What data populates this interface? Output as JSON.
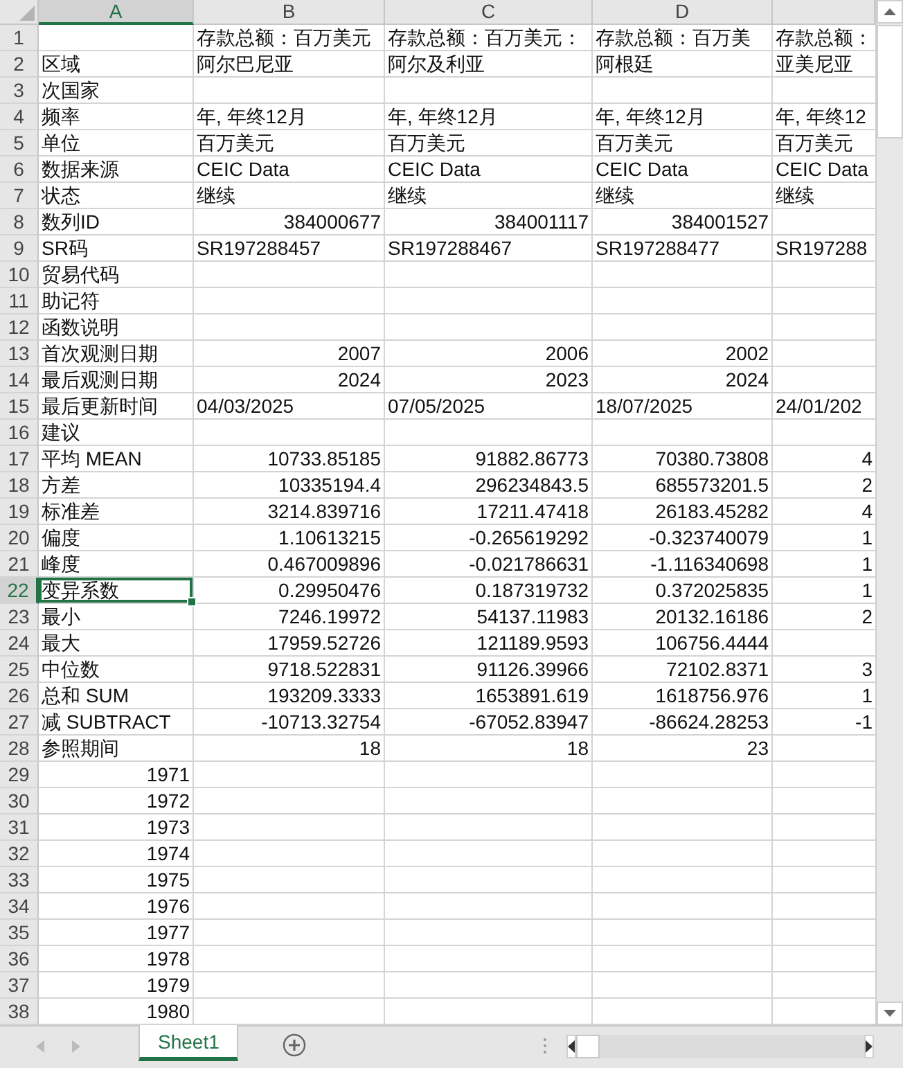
{
  "columns": [
    {
      "label": "A",
      "selected": true
    },
    {
      "label": "B",
      "selected": false
    },
    {
      "label": "C",
      "selected": false
    },
    {
      "label": "D",
      "selected": false
    }
  ],
  "rows": [
    {
      "number": "1",
      "selected": false,
      "kind": "text",
      "cells": [
        null,
        "存款总额：百万美元",
        "存款总额：百万美元：",
        "存款总额：百万美",
        "存款总额："
      ]
    },
    {
      "number": "2",
      "selected": false,
      "kind": "text",
      "cells": [
        "区域",
        "阿尔巴尼亚",
        "阿尔及利亚",
        "阿根廷",
        "亚美尼亚"
      ]
    },
    {
      "number": "3",
      "selected": false,
      "kind": "text",
      "cells": [
        "次国家",
        null,
        null,
        null,
        null
      ]
    },
    {
      "number": "4",
      "selected": false,
      "kind": "text",
      "cells": [
        "频率",
        "年, 年终12月",
        "年, 年终12月",
        "年, 年终12月",
        "年, 年终12"
      ]
    },
    {
      "number": "5",
      "selected": false,
      "kind": "text",
      "cells": [
        "单位",
        "百万美元",
        "百万美元",
        "百万美元",
        "百万美元"
      ]
    },
    {
      "number": "6",
      "selected": false,
      "kind": "text",
      "cells": [
        "数据来源",
        "CEIC Data",
        "CEIC Data",
        "CEIC Data",
        "CEIC Data"
      ]
    },
    {
      "number": "7",
      "selected": false,
      "kind": "text",
      "cells": [
        "状态",
        "继续",
        "继续",
        "继续",
        "继续"
      ]
    },
    {
      "number": "8",
      "selected": false,
      "kind": "number",
      "cells": [
        "数列ID",
        "384000677",
        "384001117",
        "384001527",
        null
      ]
    },
    {
      "number": "9",
      "selected": false,
      "kind": "text",
      "cells": [
        "SR码",
        "SR197288457",
        "SR197288467",
        "SR197288477",
        "SR197288"
      ]
    },
    {
      "number": "10",
      "selected": false,
      "kind": "text",
      "cells": [
        "贸易代码",
        null,
        null,
        null,
        null
      ]
    },
    {
      "number": "11",
      "selected": false,
      "kind": "text",
      "cells": [
        "助记符",
        null,
        null,
        null,
        null
      ]
    },
    {
      "number": "12",
      "selected": false,
      "kind": "text",
      "cells": [
        "函数说明",
        null,
        null,
        null,
        null
      ]
    },
    {
      "number": "13",
      "selected": false,
      "kind": "number",
      "cells": [
        "首次观测日期",
        "2007",
        "2006",
        "2002",
        null
      ]
    },
    {
      "number": "14",
      "selected": false,
      "kind": "number",
      "cells": [
        "最后观测日期",
        "2024",
        "2023",
        "2024",
        null
      ]
    },
    {
      "number": "15",
      "selected": false,
      "kind": "text",
      "cells": [
        "最后更新时间",
        "04/03/2025",
        "07/05/2025",
        "18/07/2025",
        "24/01/202"
      ]
    },
    {
      "number": "16",
      "selected": false,
      "kind": "text",
      "cells": [
        "建议",
        null,
        null,
        null,
        null
      ]
    },
    {
      "number": "17",
      "selected": false,
      "kind": "number",
      "cells": [
        "平均 MEAN",
        "10733.85185",
        "91882.86773",
        "70380.73808",
        "4"
      ]
    },
    {
      "number": "18",
      "selected": false,
      "kind": "number",
      "cells": [
        "方差",
        "10335194.4",
        "296234843.5",
        "685573201.5",
        "2"
      ]
    },
    {
      "number": "19",
      "selected": false,
      "kind": "number",
      "cells": [
        "标准差",
        "3214.839716",
        "17211.47418",
        "26183.45282",
        "4"
      ]
    },
    {
      "number": "20",
      "selected": false,
      "kind": "number",
      "cells": [
        "偏度",
        "1.10613215",
        "-0.265619292",
        "-0.323740079",
        "1"
      ]
    },
    {
      "number": "21",
      "selected": false,
      "kind": "number",
      "cells": [
        "峰度",
        "0.467009896",
        "-0.021786631",
        "-1.116340698",
        "1"
      ]
    },
    {
      "number": "22",
      "selected": true,
      "kind": "number",
      "cells": [
        "变异系数",
        "0.29950476",
        "0.187319732",
        "0.372025835",
        "1"
      ]
    },
    {
      "number": "23",
      "selected": false,
      "kind": "number",
      "cells": [
        "最小",
        "7246.19972",
        "54137.11983",
        "20132.16186",
        "2"
      ]
    },
    {
      "number": "24",
      "selected": false,
      "kind": "number",
      "cells": [
        "最大",
        "17959.52726",
        "121189.9593",
        "106756.4444",
        null
      ]
    },
    {
      "number": "25",
      "selected": false,
      "kind": "number",
      "cells": [
        "中位数",
        "9718.522831",
        "91126.39966",
        "72102.8371",
        "3"
      ]
    },
    {
      "number": "26",
      "selected": false,
      "kind": "number",
      "cells": [
        "总和 SUM",
        "193209.3333",
        "1653891.619",
        "1618756.976",
        "1"
      ]
    },
    {
      "number": "27",
      "selected": false,
      "kind": "number",
      "cells": [
        "减 SUBTRACT",
        "-10713.32754",
        "-67052.83947",
        "-86624.28253",
        "-1"
      ]
    },
    {
      "number": "28",
      "selected": false,
      "kind": "number",
      "cells": [
        "参照期间",
        "18",
        "18",
        "23",
        null
      ]
    },
    {
      "number": "29",
      "selected": false,
      "kind": "year",
      "cells": [
        "1971"
      ]
    },
    {
      "number": "30",
      "selected": false,
      "kind": "year",
      "cells": [
        "1972"
      ]
    },
    {
      "number": "31",
      "selected": false,
      "kind": "year",
      "cells": [
        "1973"
      ]
    },
    {
      "number": "32",
      "selected": false,
      "kind": "year",
      "cells": [
        "1974"
      ]
    },
    {
      "number": "33",
      "selected": false,
      "kind": "year",
      "cells": [
        "1975"
      ]
    },
    {
      "number": "34",
      "selected": false,
      "kind": "year",
      "cells": [
        "1976"
      ]
    },
    {
      "number": "35",
      "selected": false,
      "kind": "year",
      "cells": [
        "1977"
      ]
    },
    {
      "number": "36",
      "selected": false,
      "kind": "year",
      "cells": [
        "1978"
      ]
    },
    {
      "number": "37",
      "selected": false,
      "kind": "year",
      "cells": [
        "1979"
      ]
    },
    {
      "number": "38",
      "selected": false,
      "kind": "year",
      "cells": [
        "1980"
      ]
    }
  ],
  "sheets": [
    {
      "label": "Sheet1",
      "selected": true
    }
  ]
}
